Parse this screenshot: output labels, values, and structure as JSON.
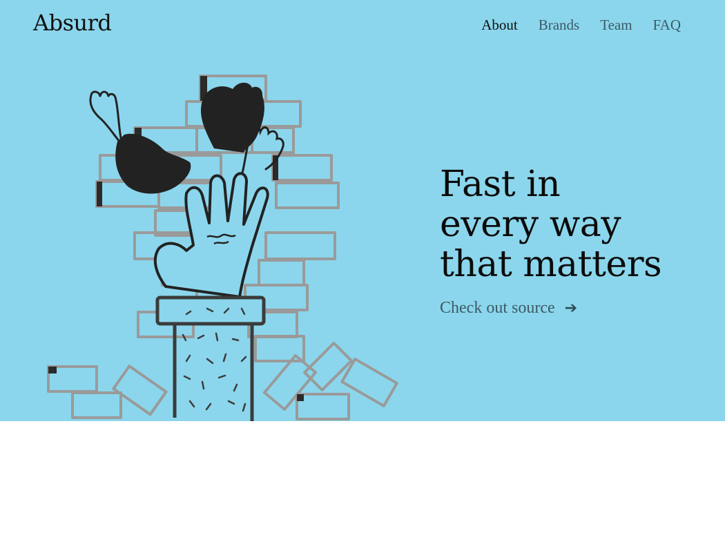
{
  "brand": {
    "name": "Absurd"
  },
  "nav": {
    "items": [
      {
        "label": "About",
        "active": true
      },
      {
        "label": "Brands",
        "active": false
      },
      {
        "label": "Team",
        "active": false
      },
      {
        "label": "FAQ",
        "active": false
      }
    ]
  },
  "hero": {
    "headline": [
      "Fast in",
      "every way",
      "that matters"
    ],
    "cta_label": "Check out source",
    "cta_icon": "arrow-right-icon",
    "background_color": "#8bd6ec",
    "illustration": "hands-reaching-from-brick-wall"
  }
}
